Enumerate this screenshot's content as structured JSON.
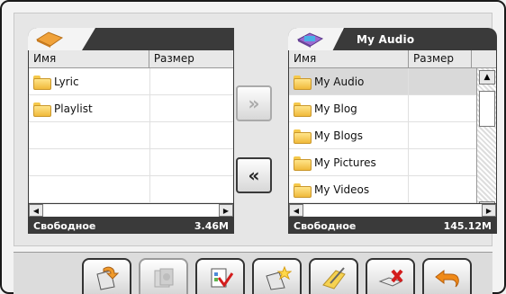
{
  "left_panel": {
    "title": "",
    "columns": [
      "Имя",
      "Размер"
    ],
    "items": [
      {
        "name": "Lyric",
        "size": ""
      },
      {
        "name": "Playlist",
        "size": ""
      }
    ],
    "status_label": "Свободное",
    "status_value": "3.46M"
  },
  "right_panel": {
    "title": "My Audio",
    "columns": [
      "Имя",
      "Размер"
    ],
    "items": [
      {
        "name": "My Audio",
        "size": ""
      },
      {
        "name": "My Blog",
        "size": ""
      },
      {
        "name": "My Blogs",
        "size": ""
      },
      {
        "name": "My Pictures",
        "size": ""
      },
      {
        "name": "My Videos",
        "size": ""
      }
    ],
    "status_label": "Свободное",
    "status_value": "145.12M"
  },
  "transfer": {
    "copy_right": "»",
    "copy_left": "«"
  },
  "toolbar": {
    "buttons": [
      {
        "icon": "import-file-icon"
      },
      {
        "icon": "properties-icon"
      },
      {
        "icon": "edit-list-icon"
      },
      {
        "icon": "new-folder-icon"
      },
      {
        "icon": "rename-icon"
      },
      {
        "icon": "delete-icon"
      },
      {
        "icon": "back-icon"
      }
    ]
  },
  "colors": {
    "header_dark": "#3a3a3a",
    "folder": "#f0b93a",
    "delete": "#d31d1d",
    "back": "#f08a18"
  }
}
